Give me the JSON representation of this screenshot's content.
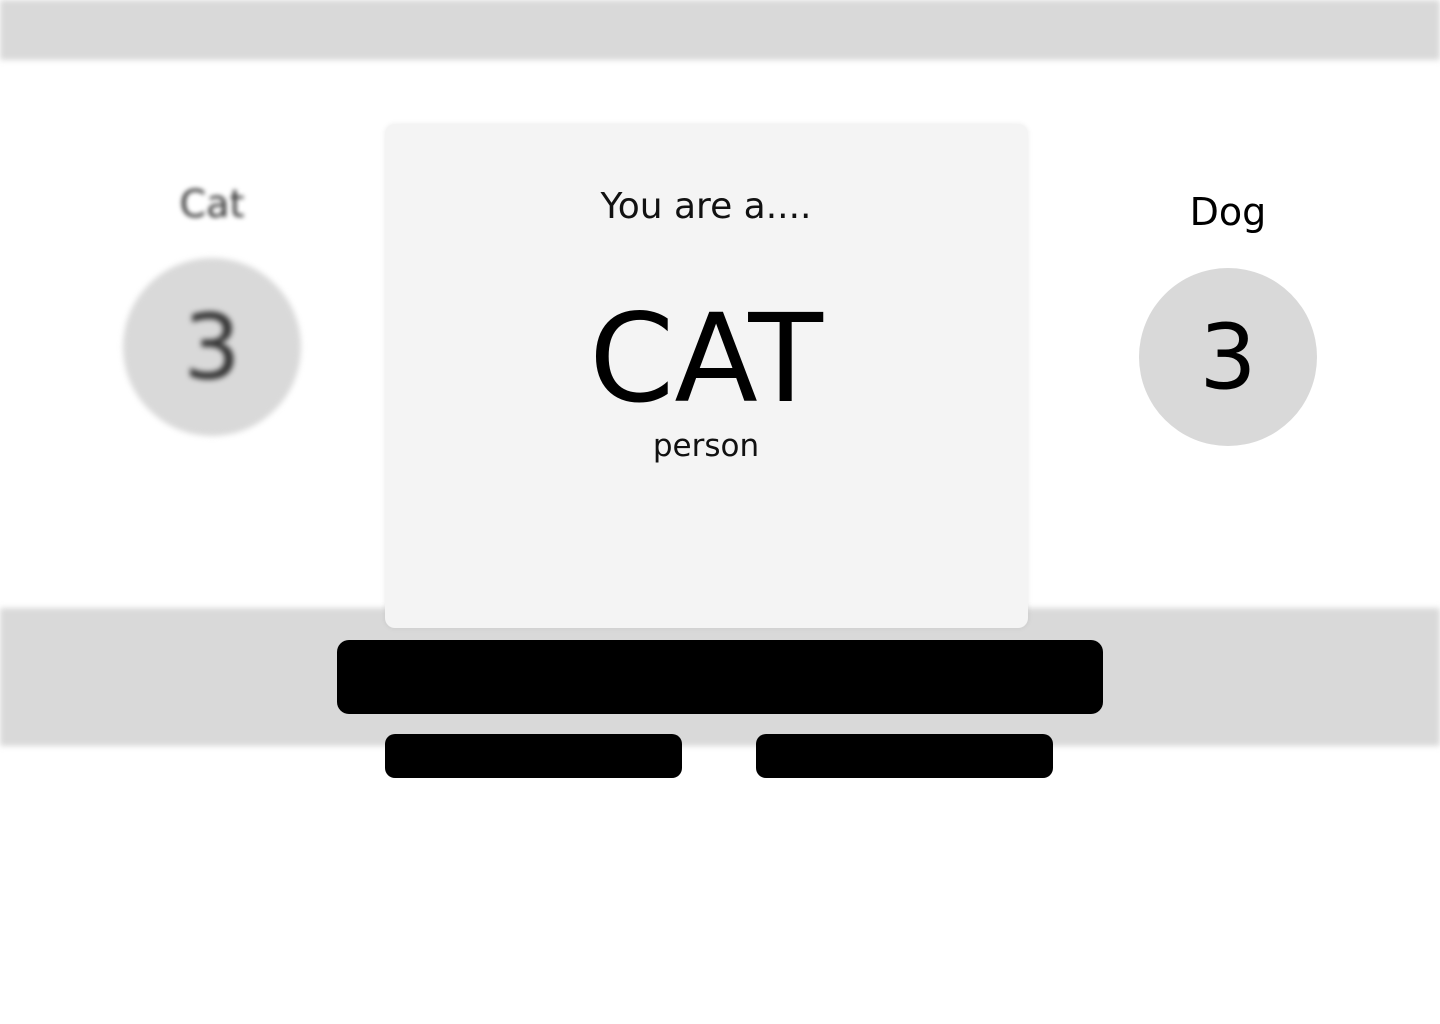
{
  "scoreboard": {
    "cat": {
      "label": "Cat",
      "score": "3"
    },
    "dog": {
      "label": "Dog",
      "score": "3"
    }
  },
  "result_modal": {
    "heading": "You are a....",
    "result": "CAT",
    "subtitle": "person"
  },
  "colors": {
    "background": "#ffffff",
    "panel_gray": "#d9d9d9",
    "modal_bg": "#f4f4f4",
    "button_bg": "#000000"
  }
}
